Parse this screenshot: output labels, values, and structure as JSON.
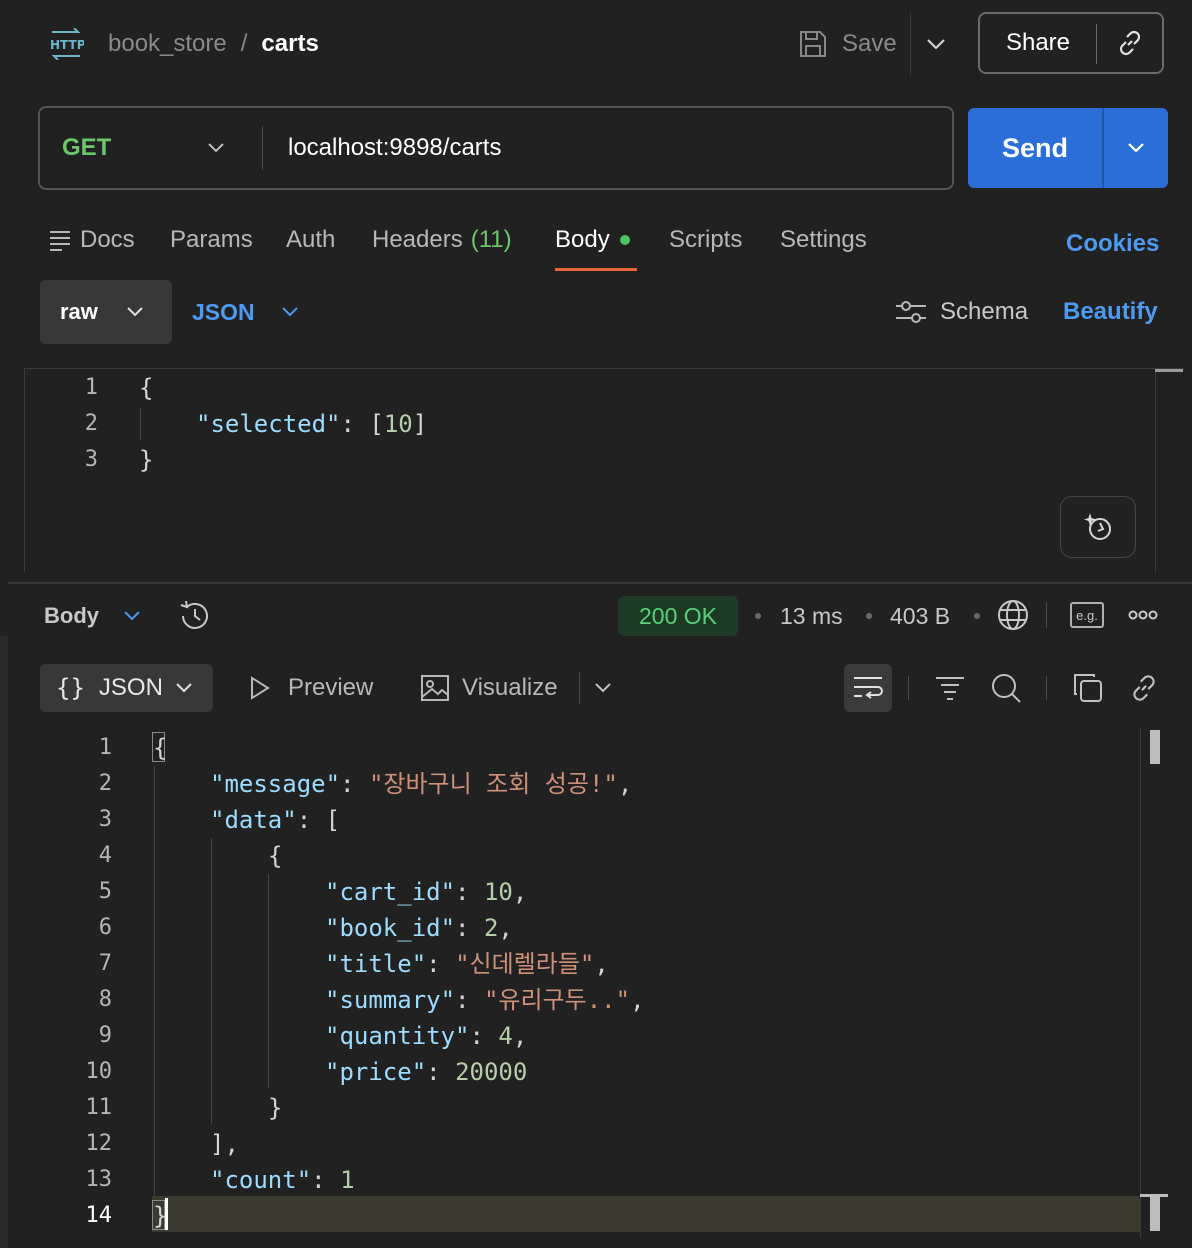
{
  "header": {
    "collection": "book_store",
    "separator": "/",
    "request_name": "carts",
    "save_label": "Save",
    "share_label": "Share"
  },
  "request": {
    "method": "GET",
    "url": "localhost:9898/carts",
    "send_label": "Send"
  },
  "tabs": {
    "docs": "Docs",
    "params": "Params",
    "auth": "Auth",
    "headers": "Headers",
    "headers_count": "(11)",
    "body": "Body",
    "scripts": "Scripts",
    "settings": "Settings",
    "cookies": "Cookies"
  },
  "body_toolbar": {
    "mode": "raw",
    "format": "JSON",
    "schema": "Schema",
    "beautify": "Beautify"
  },
  "request_body": {
    "line_numbers": [
      "1",
      "2",
      "3"
    ]
  },
  "response": {
    "section_label": "Body",
    "status": "200 OK",
    "time": "13 ms",
    "size": "403 B",
    "example_label": "e.g.",
    "format_label": "JSON",
    "preview_label": "Preview",
    "visualize_label": "Visualize",
    "line_numbers": [
      "1",
      "2",
      "3",
      "4",
      "5",
      "6",
      "7",
      "8",
      "9",
      "10",
      "11",
      "12",
      "13",
      "14"
    ]
  },
  "colors": {
    "background": "#212121",
    "accent_blue": "#2b6ed8",
    "link_blue": "#4d9af0",
    "method_green": "#6cc76a",
    "status_green": "#57d17a",
    "tab_indicator": "#e8623a",
    "json_key": "#9cdcfe",
    "json_string": "#ce9178",
    "json_number": "#b5cea8"
  }
}
